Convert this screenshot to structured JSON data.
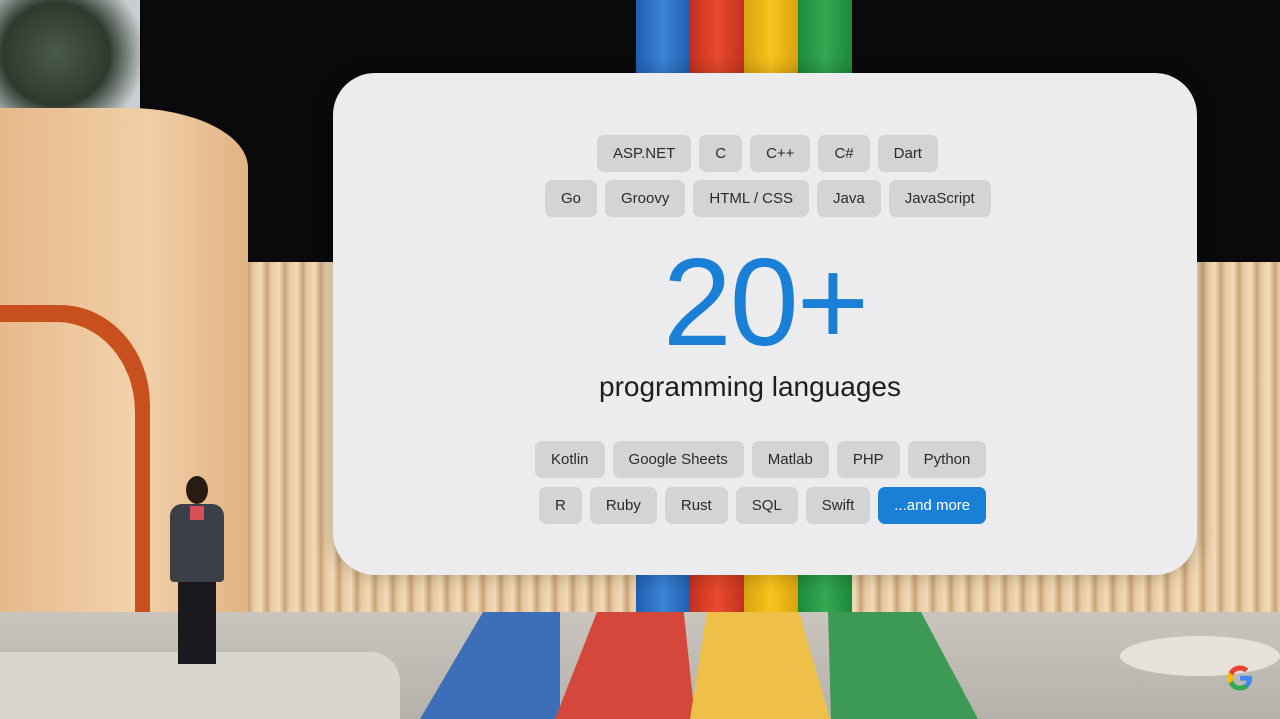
{
  "slide": {
    "top_row_1": [
      "ASP.NET",
      "C",
      "C++",
      "C#",
      "Dart"
    ],
    "top_row_2": [
      "Go",
      "Groovy",
      "HTML / CSS",
      "Java",
      "JavaScript"
    ],
    "headline": "20+",
    "subheadline": "programming languages",
    "bottom_row_1": [
      "Kotlin",
      "Google Sheets",
      "Matlab",
      "PHP",
      "Python"
    ],
    "bottom_row_2": [
      "R",
      "Ruby",
      "Rust",
      "SQL",
      "Swift"
    ],
    "more_chip": "...and more"
  },
  "colors": {
    "accent_blue": "#1a7fd6",
    "chip_gray": "#d4d4d6",
    "card_bg": "#ececee"
  },
  "watermark": {
    "icon": "google-g-logo"
  }
}
